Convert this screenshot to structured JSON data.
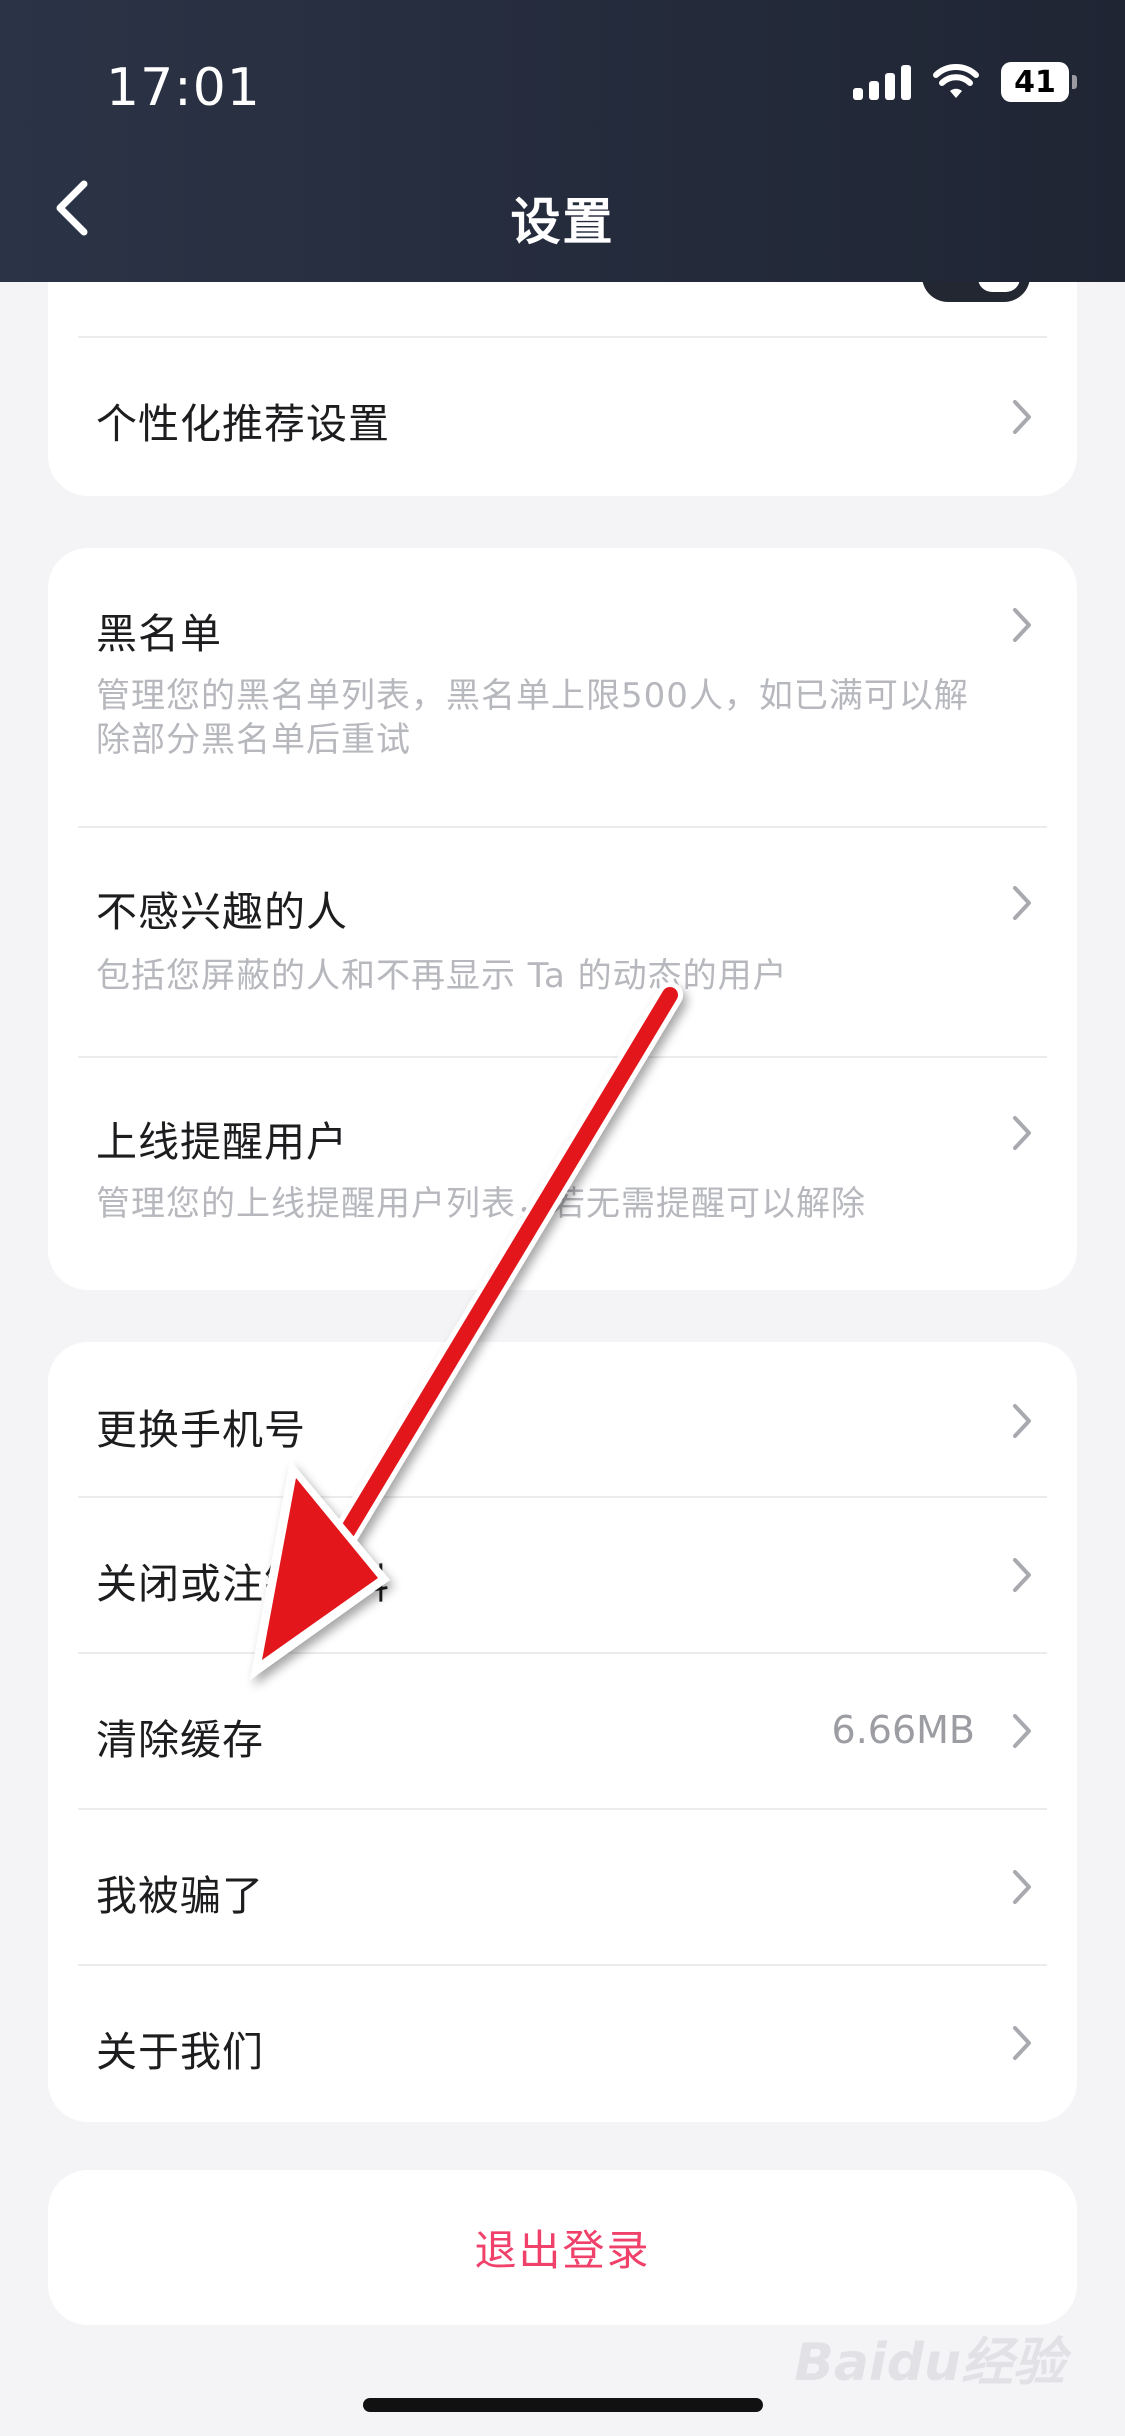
{
  "status_bar": {
    "time": "17:01",
    "battery": "41"
  },
  "header": {
    "title": "设置"
  },
  "card1": {
    "items": [
      {
        "label": "个性化推荐设置"
      }
    ]
  },
  "card2": {
    "items": [
      {
        "label": "黑名单",
        "sub": "管理您的黑名单列表，黑名单上限500人，如已满可以解除部分黑名单后重试"
      },
      {
        "label": "不感兴趣的人",
        "sub": "包括您屏蔽的人和不再显示 Ta 的动态的用户"
      },
      {
        "label": "上线提醒用户",
        "sub": "管理您的上线提醒用户列表，若无需提醒可以解除"
      }
    ]
  },
  "card3": {
    "items": [
      {
        "label": "更换手机号"
      },
      {
        "label": "关闭或注销资料"
      },
      {
        "label": "清除缓存",
        "value": "6.66MB"
      },
      {
        "label": "我被骗了"
      },
      {
        "label": "关于我们"
      }
    ]
  },
  "logout": {
    "label": "退出登录"
  },
  "watermark": {
    "text": "Baidu经验"
  },
  "colors": {
    "accent": "#f0416a",
    "header": "#232a38",
    "arrow": "#e3141b"
  }
}
